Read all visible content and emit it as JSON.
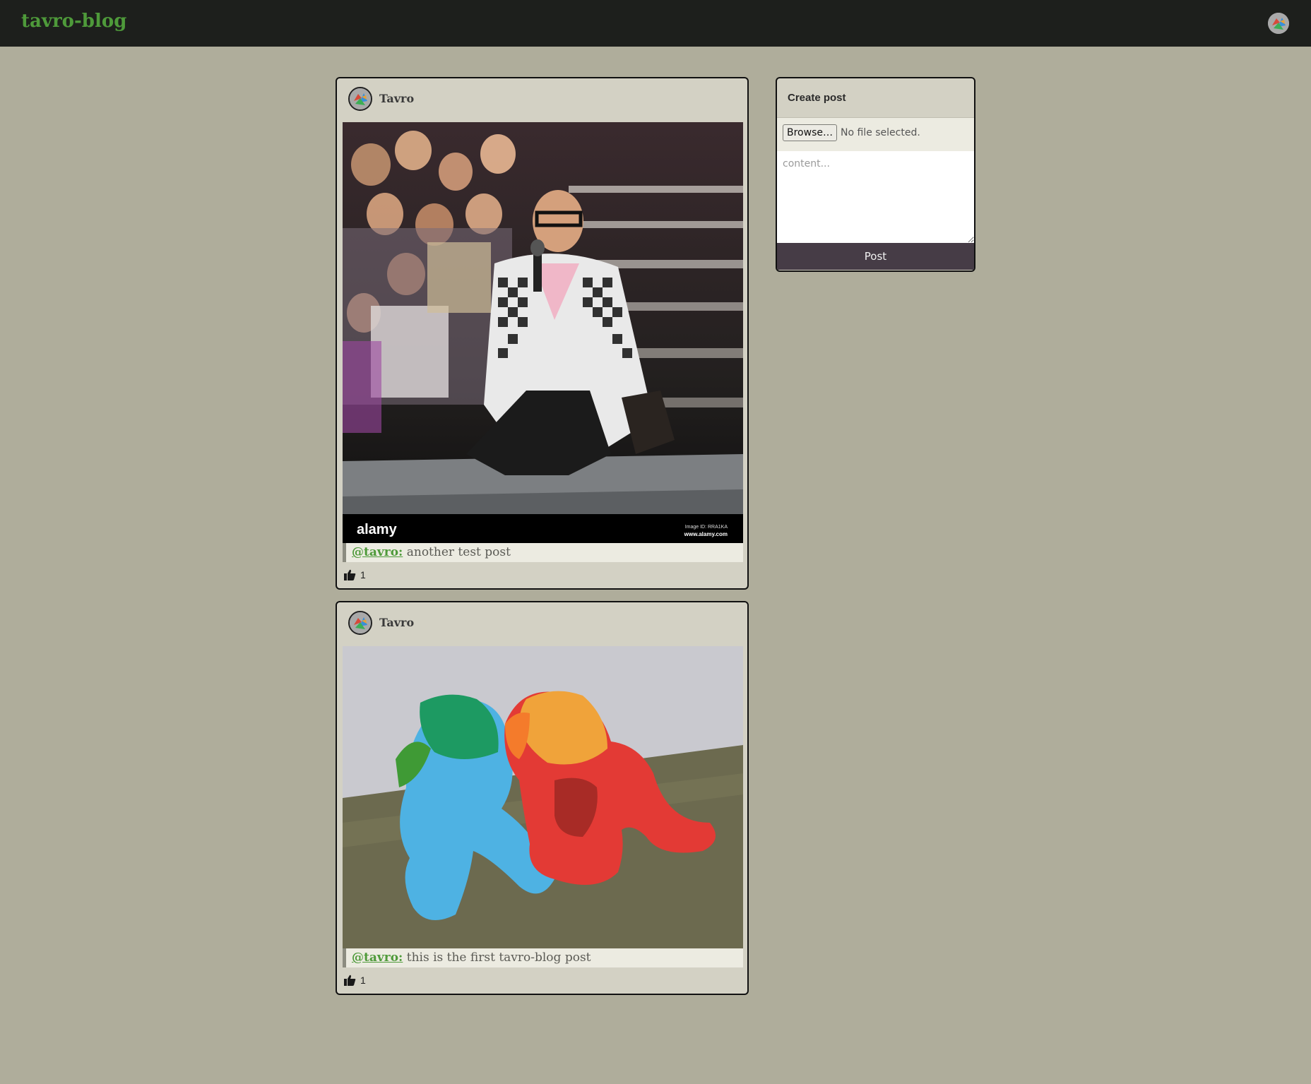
{
  "app": {
    "brand": "tavro-blog"
  },
  "posts": [
    {
      "author": "Tavro",
      "mention": "@tavro:",
      "text": "another test post",
      "likes": "1"
    },
    {
      "author": "Tavro",
      "mention": "@tavro:",
      "text": "this is the first tavro-blog post",
      "likes": "1"
    }
  ],
  "create_post": {
    "title": "Create post",
    "browse_label": "Browse…",
    "file_status": "No file selected.",
    "content_placeholder": "content...",
    "post_label": "Post"
  },
  "watermark": {
    "brand": "alamy",
    "image_id": "Image ID: RRA1KA",
    "url": "www.alamy.com"
  }
}
